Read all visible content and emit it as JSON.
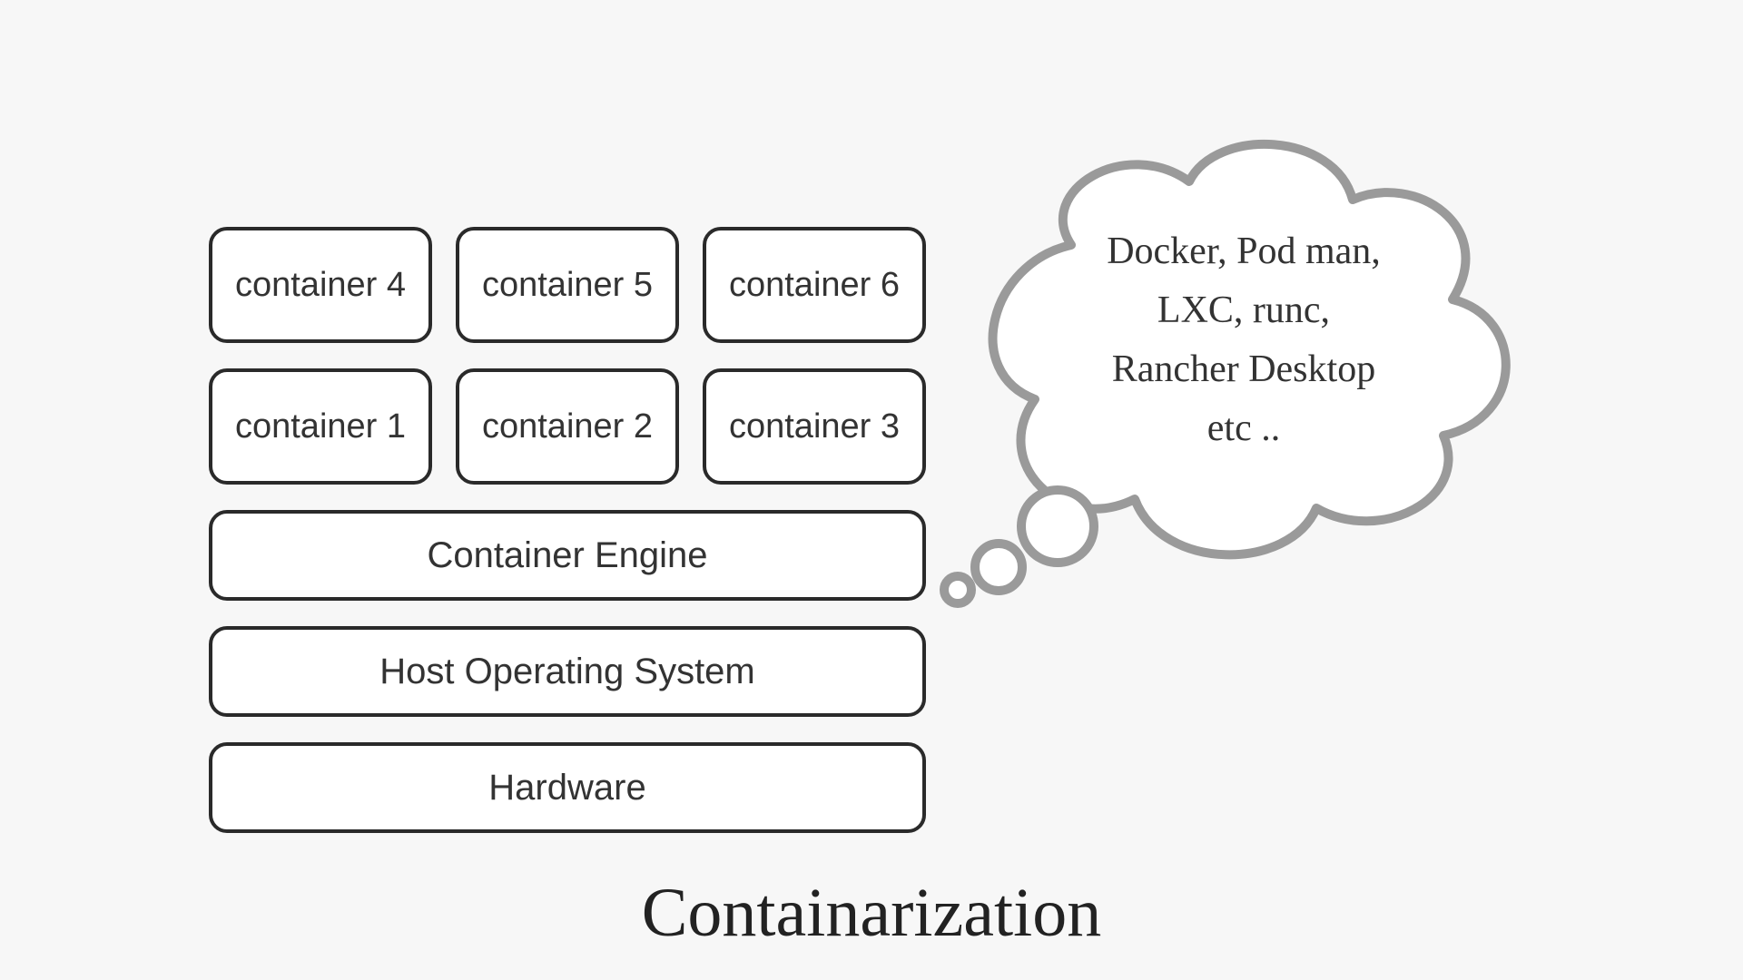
{
  "title": "Containarization",
  "stack": {
    "containers_top": [
      "container 4",
      "container 5",
      "container 6"
    ],
    "containers_bottom": [
      "container 1",
      "container 2",
      "container 3"
    ],
    "engine": "Container Engine",
    "os": "Host Operating System",
    "hardware": "Hardware"
  },
  "thought": {
    "line1": "Docker, Pod man,",
    "line2": "LXC, runc,",
    "line3": "Rancher Desktop",
    "line4": "etc .."
  }
}
